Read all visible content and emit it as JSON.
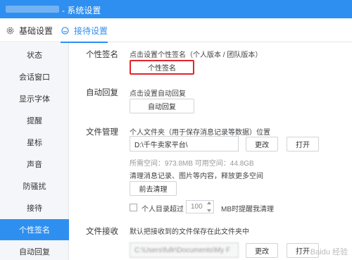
{
  "window": {
    "title": "- 系统设置"
  },
  "tabs": [
    {
      "label": "基础设置"
    },
    {
      "label": "接待设置"
    }
  ],
  "sidebar": {
    "items": [
      {
        "label": "状态"
      },
      {
        "label": "会话窗口"
      },
      {
        "label": "显示字体"
      },
      {
        "label": "提醒"
      },
      {
        "label": "星标"
      },
      {
        "label": "声音"
      },
      {
        "label": "防骚扰"
      },
      {
        "label": "接待"
      },
      {
        "label": "个性签名",
        "active": true
      },
      {
        "label": "自动回复"
      }
    ]
  },
  "signature": {
    "label": "个性签名",
    "desc": "点击设置个性签名（个人版本 / 团队版本）",
    "button": "个性签名"
  },
  "auto_reply": {
    "label": "自动回复",
    "desc": "点击设置自动回复",
    "button": "自动回复"
  },
  "file_manage": {
    "label": "文件管理",
    "desc": "个人文件夹（用于保存消息记录等数据）位置",
    "path_value": "D:\\千牛卖家平台\\",
    "change_button": "更改",
    "open_button": "打开",
    "space_info": "所需空间：973.8MB   可用空间：44.8GB",
    "clean_desc": "清理消息记录、图片等内容，释放更多空间",
    "clean_button": "前去清理",
    "check_label": "个人目录超过",
    "threshold_value": "100",
    "threshold_suffix": "MB时提醒我清理"
  },
  "file_receive": {
    "label": "文件接收",
    "desc": "默认把接收到的文件保存在此文件夹中",
    "path_value": "C:\\Users\\fullr\\Documents\\My F",
    "change_button": "更改",
    "open_button": "打开"
  },
  "watermark": "Baidu 经验"
}
